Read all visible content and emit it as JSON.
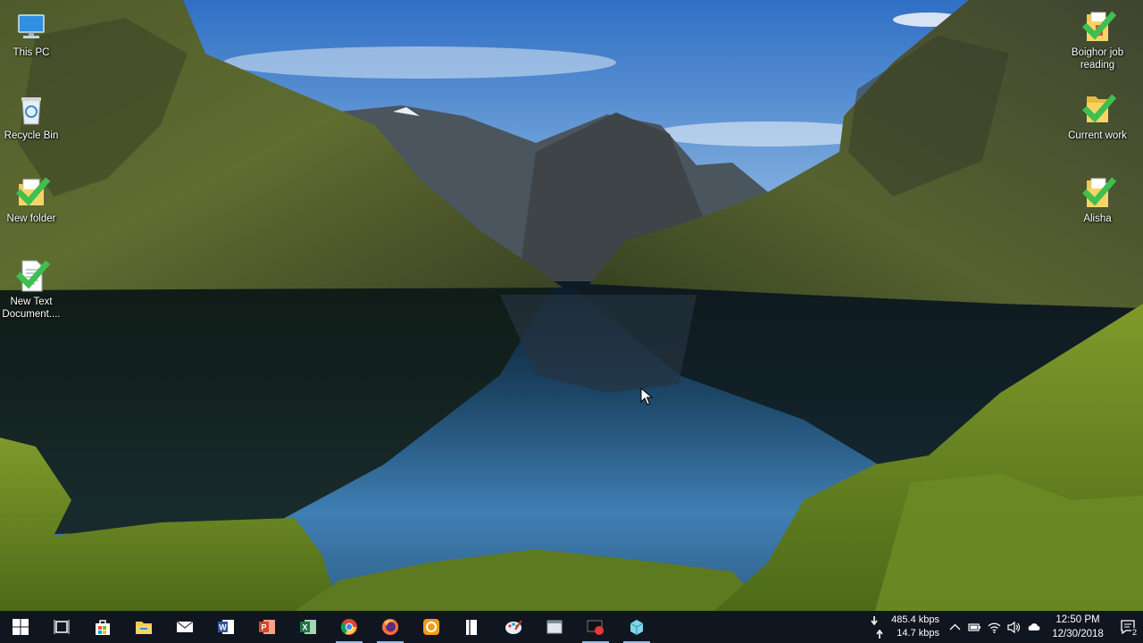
{
  "desktop": {
    "icons_left": [
      {
        "label": "This PC",
        "icon": "computer-icon"
      },
      {
        "label": "Recycle Bin",
        "icon": "recycle-bin-icon"
      },
      {
        "label": "New folder",
        "icon": "folder-icon"
      },
      {
        "label": "New Text Document....",
        "icon": "text-document-icon"
      }
    ],
    "icons_right": [
      {
        "label": "Boighor job reading",
        "icon": "folder-icon"
      },
      {
        "label": "Current work",
        "icon": "folder-icon"
      },
      {
        "label": "Alisha",
        "icon": "folder-icon"
      }
    ]
  },
  "taskbar": {
    "apps": [
      {
        "name": "start",
        "icon": "windows-logo-icon"
      },
      {
        "name": "task-view",
        "icon": "task-view-icon"
      },
      {
        "name": "store",
        "icon": "store-icon"
      },
      {
        "name": "file-explorer",
        "icon": "file-explorer-icon"
      },
      {
        "name": "mail",
        "icon": "mail-icon"
      },
      {
        "name": "word",
        "icon": "word-icon"
      },
      {
        "name": "powerpoint",
        "icon": "powerpoint-icon"
      },
      {
        "name": "excel",
        "icon": "excel-icon"
      },
      {
        "name": "chrome",
        "icon": "chrome-icon",
        "running": true
      },
      {
        "name": "firefox",
        "icon": "firefox-icon",
        "running": true
      },
      {
        "name": "app-orange",
        "icon": "orange-app-icon"
      },
      {
        "name": "reader",
        "icon": "book-icon"
      },
      {
        "name": "paint",
        "icon": "paint-icon"
      },
      {
        "name": "app-window",
        "icon": "window-app-icon"
      },
      {
        "name": "recorder",
        "icon": "screen-recorder-icon",
        "running": true
      },
      {
        "name": "app-cube",
        "icon": "cube-app-icon",
        "running": true
      }
    ],
    "network_speed": {
      "down": "485.4 kbps",
      "up": "14.7 kbps"
    },
    "clock": {
      "time": "12:50 PM",
      "date": "12/30/2018"
    },
    "notification_count": "2"
  },
  "colors": {
    "taskbar_bg": "#10161e",
    "folder_yellow": "#f3c94a",
    "sync_green": "#3fbf4f"
  }
}
